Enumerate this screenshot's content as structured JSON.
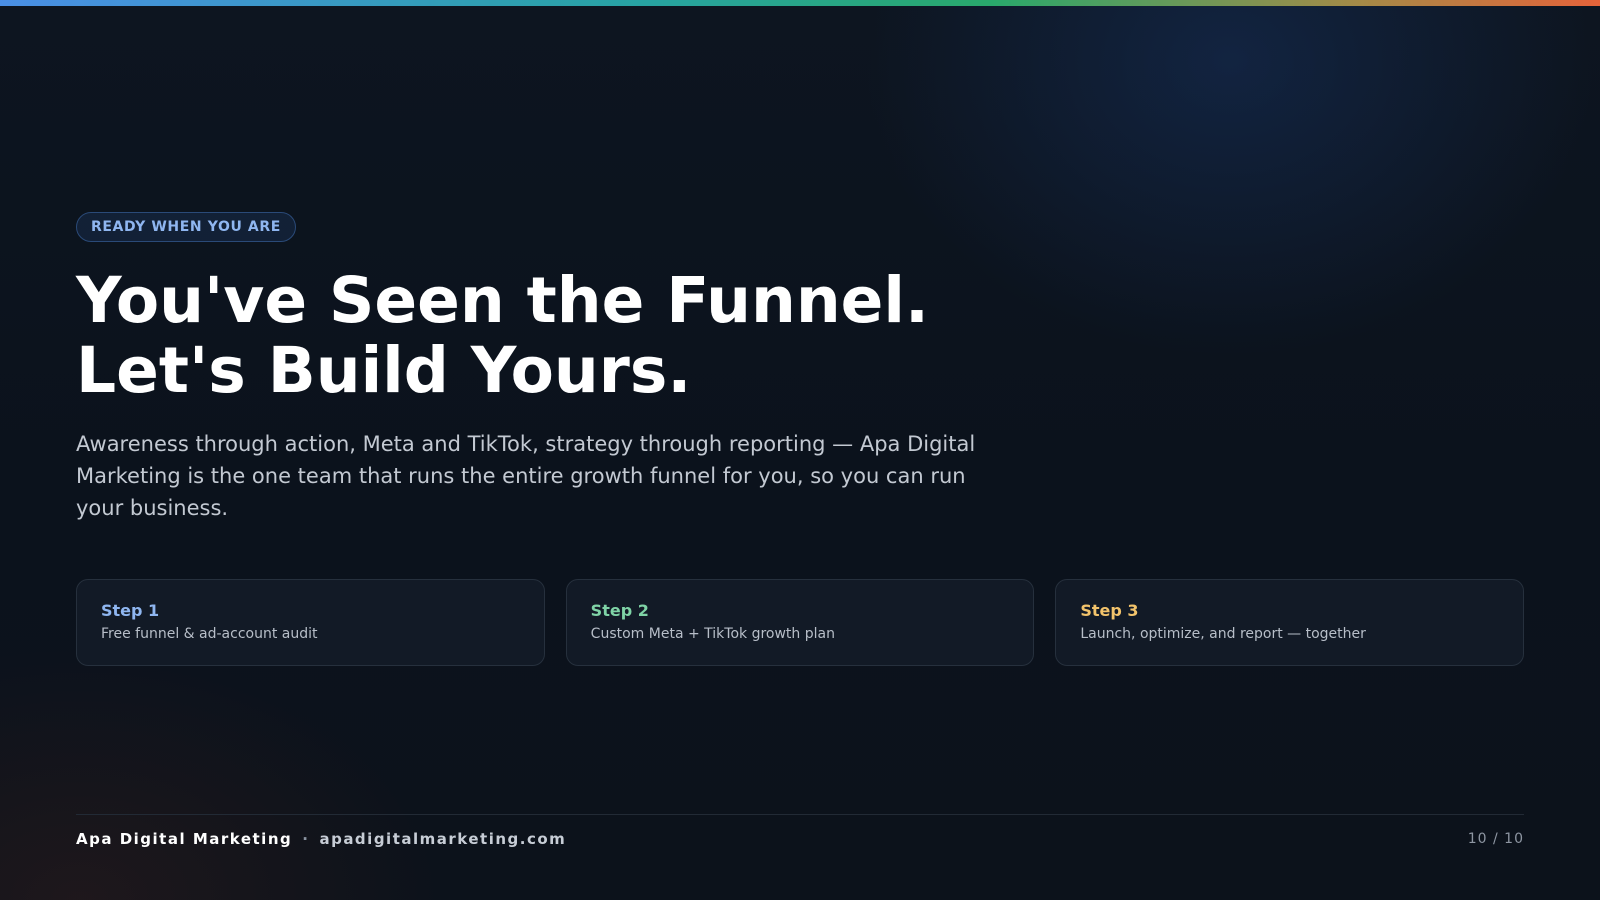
{
  "accent_colors": {
    "eyebrow_text": "#8fb6f0",
    "step_1": "#8fb6f0",
    "step_2": "#7fd3a6",
    "step_3": "#f2c36b"
  },
  "slide": {
    "eyebrow": "READY WHEN YOU ARE",
    "headline_line_1": "You've Seen the Funnel.",
    "headline_line_2": "Let's Build Yours.",
    "subtitle": "Awareness through action, Meta and TikTok, strategy through reporting — Apa Digital Marketing is the one team that runs the entire growth funnel for you, so you can run your business."
  },
  "steps": [
    {
      "title": "Step 1",
      "description": "Free funnel & ad-account audit"
    },
    {
      "title": "Step 2",
      "description": "Custom Meta + TikTok growth plan"
    },
    {
      "title": "Step 3",
      "description": "Launch, optimize, and report — together"
    }
  ],
  "footer": {
    "brand": "Apa Digital Marketing",
    "separator": "·",
    "website": "apadigitalmarketing.com",
    "page_counter": "10 / 10"
  }
}
